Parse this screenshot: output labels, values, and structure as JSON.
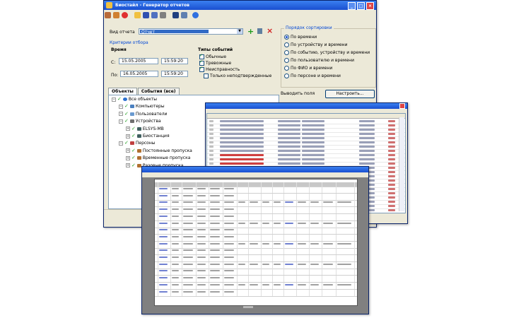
{
  "window": {
    "title": "Биостайл - Генератор отчетов"
  },
  "toolbar": {
    "icons": [
      "people-icon",
      "open-icon",
      "stop-icon",
      "folder-icon",
      "save-icon",
      "save-as-icon",
      "edit-icon",
      "print-icon",
      "preview-icon",
      "help-icon"
    ]
  },
  "report_type": {
    "label": "Вид отчета",
    "value": "Отчет"
  },
  "criteria": {
    "heading": "Критерии отбора",
    "time_label": "Время",
    "from_label": "С:",
    "to_label": "По:",
    "from_date": "15.05.2005",
    "from_time": "15:59:20",
    "to_date": "16.05.2005",
    "to_time": "15:59:20"
  },
  "event_types": {
    "heading": "Типы событий",
    "items": [
      {
        "label": "Обычные",
        "checked": true
      },
      {
        "label": "Тревожные",
        "checked": true
      },
      {
        "label": "Неисправность",
        "checked": true
      },
      {
        "label": "Только неподтвержденные",
        "checked": false
      }
    ]
  },
  "sort": {
    "heading": "Порядок сортировки",
    "options": [
      {
        "label": "По времени",
        "selected": true
      },
      {
        "label": "По устройству и времени",
        "selected": false
      },
      {
        "label": "По событию, устройству и времени",
        "selected": false
      },
      {
        "label": "По пользователю и времени",
        "selected": false
      },
      {
        "label": "По ФИО и времени",
        "selected": false
      },
      {
        "label": "По персоне и времени",
        "selected": false
      }
    ]
  },
  "output_fields": {
    "label": "Выводить поля",
    "button": "Настроить..."
  },
  "tabs": [
    {
      "label": "Объекты",
      "active": true
    },
    {
      "label": "События (все)",
      "active": false
    }
  ],
  "tree": [
    {
      "label": "Все объекты",
      "level": 0,
      "icon": "globe-icon"
    },
    {
      "label": "Компьютеры",
      "level": 1,
      "icon": "computer-icon"
    },
    {
      "label": "Пользователи",
      "level": 1,
      "icon": "user-icon"
    },
    {
      "label": "Устройства",
      "level": 1,
      "icon": "device-icon"
    },
    {
      "label": "ELSYS-MB",
      "level": 2,
      "icon": "controller-icon"
    },
    {
      "label": "Биостанция",
      "level": 2,
      "icon": "controller-icon"
    },
    {
      "label": "Персоны",
      "level": 1,
      "icon": "person-icon"
    },
    {
      "label": "Постоянные пропуска",
      "level": 2,
      "icon": "pass-icon"
    },
    {
      "label": "Временные пропуска",
      "level": 2,
      "icon": "pass-icon"
    },
    {
      "label": "Разовые пропуска",
      "level": 2,
      "icon": "pass-icon"
    }
  ],
  "colors": {
    "title_bar": "#1a4fd0",
    "window_bg": "#ece9d8",
    "selection": "#316ac5",
    "check": "#21a121",
    "event_alarm": "#d04040"
  }
}
